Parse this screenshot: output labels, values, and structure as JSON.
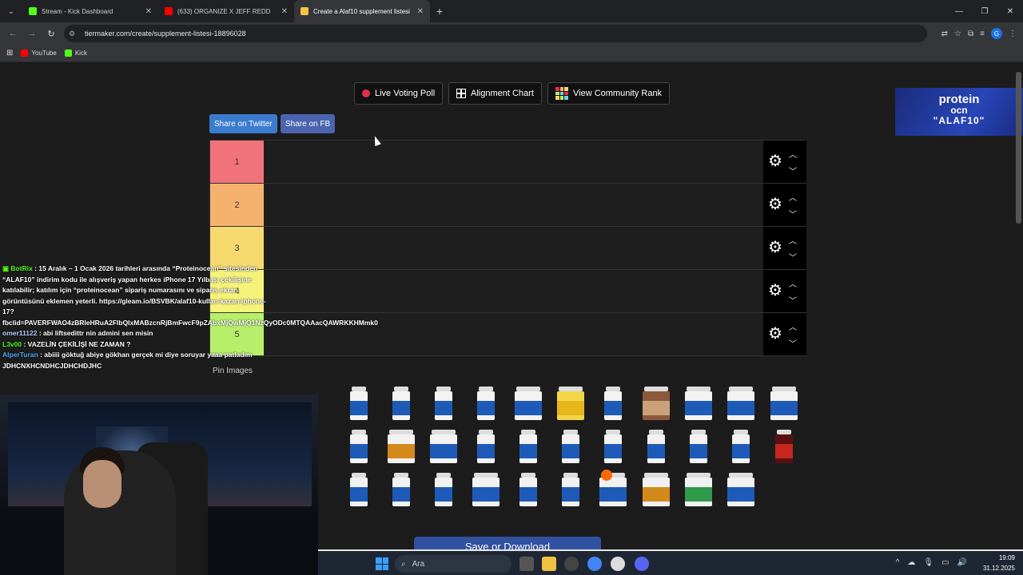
{
  "browser": {
    "tabs": [
      {
        "label": "Stream - Kick Dashboard",
        "color": "#53fc18"
      },
      {
        "label": "(633) ORGANIZE X JEFF REDD",
        "color": "#ff0000"
      },
      {
        "label": "Create a Alaf10 supplement listesi",
        "color": "#f5c542"
      }
    ],
    "url": "tiermaker.com/create/supplement-listesi-18896028",
    "bookmarks": [
      {
        "label": "YouTube",
        "color": "#ff0000"
      },
      {
        "label": "Kick",
        "color": "#53fc18"
      }
    ],
    "new_tab": "+",
    "profile_initial": "G"
  },
  "page": {
    "buttons": {
      "live_voting": "Live Voting Poll",
      "alignment": "Alignment Chart",
      "community_rank": "View Community Rank",
      "share_twitter": "Share on Twitter",
      "share_fb": "Share on FB"
    },
    "tiers": [
      {
        "label": "1",
        "color": "#f0727b"
      },
      {
        "label": "2",
        "color": "#f5b26f"
      },
      {
        "label": "3",
        "color": "#f7da6f"
      },
      {
        "label": "4",
        "color": "#f5f27a"
      },
      {
        "label": "5",
        "color": "#b8ef6a"
      }
    ],
    "pin_images": "Pin Images",
    "save_download": "Save or Download",
    "ad": {
      "line1": "protein",
      "line2": "ocn",
      "line3": "\"ALAF10\""
    }
  },
  "chat": [
    {
      "user": "BotRix",
      "text": ": 15 Aralık – 1 Ocak 2026 tarihleri arasında “Proteinocean” sitesinden “ALAF10” indirim kodu ile alışveriş yapan herkes iPhone 17 Yılbaşı çekilişine katılabilir; katılım için “proteinocean” sipariş numarasını ve sipariş ekran görüntüsünü eklemen yeterli. https://gleam.io/BSVBK/alaf10-kullan-kazan-iphone-17?fbclid=PAVERFWAO4zBRleHRuA2FlbQIxMABzcnRjBmFwcF9pZAbxMjQwMjQ1NzQyODc0MTQAAacQAWRKKHMmk0"
    },
    {
      "user": "omer11122",
      "text": ": abi liftsedittr nin admini sen misin"
    },
    {
      "user": "L3v00",
      "text": ": VAZELİN ÇEKİLİŞİ NE ZAMAN ?"
    },
    {
      "user": "AlperTuran",
      "text": ": abiiii göktuğ abiye gökhan gerçek mi diye soruyar yaaa patladım JDHCNXHCNDHCJDHCHDJHC"
    }
  ],
  "taskbar": {
    "search": "Ara",
    "time": "19:09",
    "date": "31.12.2025"
  }
}
